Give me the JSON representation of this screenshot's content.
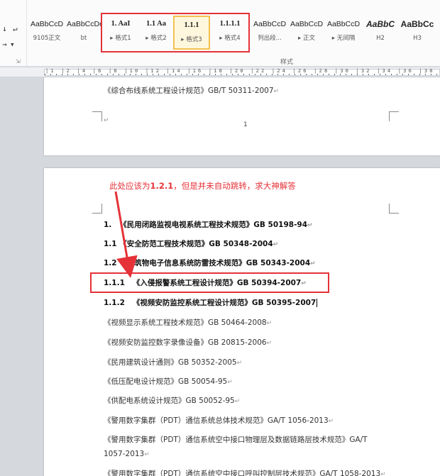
{
  "ribbon": {
    "left_buttons": [
      "↓",
      "↵",
      "→",
      "▾"
    ],
    "group_label": "样式",
    "launcher_icon": "dialog-launcher-icon",
    "styles": [
      {
        "sample": "AaBbCcD",
        "name": "9105正文"
      },
      {
        "sample": "AaBbCcDd",
        "name": "bt"
      },
      {
        "sample": "1.  AaI",
        "name": "▸ 格式1"
      },
      {
        "sample": "1.1  Aa",
        "name": "▸ 格式2"
      },
      {
        "sample": "1.1.1",
        "name": "▸ 格式3",
        "selected": true
      },
      {
        "sample": "1.1.1.1",
        "name": "▸ 格式4"
      },
      {
        "sample": "AaBbCcD",
        "name": "列出段..."
      },
      {
        "sample": "AaBbCcD",
        "name": "▸ 正文"
      },
      {
        "sample": "AaBbCcD",
        "name": "▸ 无间隔"
      },
      {
        "sample": "AaBbC",
        "name": "H2"
      },
      {
        "sample": "AaBbCc",
        "name": "H3"
      }
    ]
  },
  "ruler": {
    "numbers": "|1 |2 |4 |6 |8 |10 |12 |14 |16 |18 |20 |22 |24 |26 |28 |30 |32 |34 |36 |38 |40 |42 |44 |46 |"
  },
  "page1": {
    "line": "《综合布线系统工程设计规范》GB/T 50311-2007",
    "page_number": "1",
    "para_mark": "↵"
  },
  "annotation": {
    "prefix": "此处应该为",
    "emphasis": "1.2.1",
    "suffix": "，但是并未自动跳转，求大神解答"
  },
  "page2": {
    "para_mark": "↵",
    "headings": [
      {
        "num": "1.",
        "text": "《民用闭路监视电视系统工程技术规范》GB    50198-94"
      },
      {
        "num": "1.1",
        "text": "《安全防范工程技术规范》GB    50348-2004"
      },
      {
        "num": "1.2",
        "text": "《建筑物电子信息系统防雷技术规范》GB    50343-2004"
      },
      {
        "num": "1.1.1",
        "text": "《入侵报警系统工程设计规范》GB    50394-2007"
      },
      {
        "num": "1.1.2",
        "text": "《视频安防监控系统工程设计规范》GB    50395-2007"
      }
    ],
    "body_lines": [
      "《视频显示系统工程技术规范》GB    50464-2008",
      "《视频安防监控数字录像设备》GB    20815-2006",
      "《民用建筑设计通则》GB  50352-2005",
      "《低压配电设计规范》GB  50054-95",
      "《供配电系统设计规范》GB  50052-95",
      "《警用数字集群（PDT）通信系统总体技术规范》GA/T 1056-2013",
      "《警用数字集群（PDT）通信系统空中接口物理层及数据链路层技术规范》GA/T",
      "1057-2013",
      "《警用数字集群（PDT）通信系统空中接口呼叫控制层技术规范》GA/T 1058-2013"
    ]
  },
  "colors": {
    "annotation_red": "#e53238",
    "selected_style_border": "#f2c14f"
  }
}
